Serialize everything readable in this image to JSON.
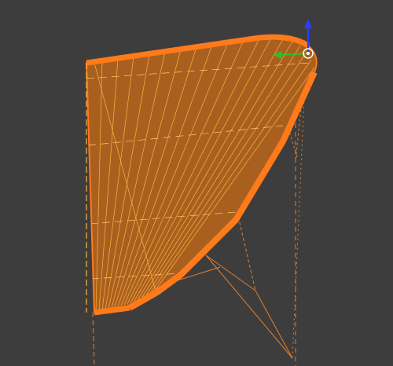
{
  "viewport": {
    "background_color": "#3d3d3d",
    "selection_color": "#ff7a1a",
    "mesh_fill_color": "#b8651f",
    "wire_color": "#ffb040",
    "gizmo": {
      "z_axis_color": "#2f3cff",
      "y_axis_color": "#27c427",
      "pivot_color": "#ffffff"
    },
    "icons": {
      "object": "mesh-object-icon",
      "gizmo": "transform-gizmo-icon",
      "pivot": "pivot-point-icon"
    }
  }
}
